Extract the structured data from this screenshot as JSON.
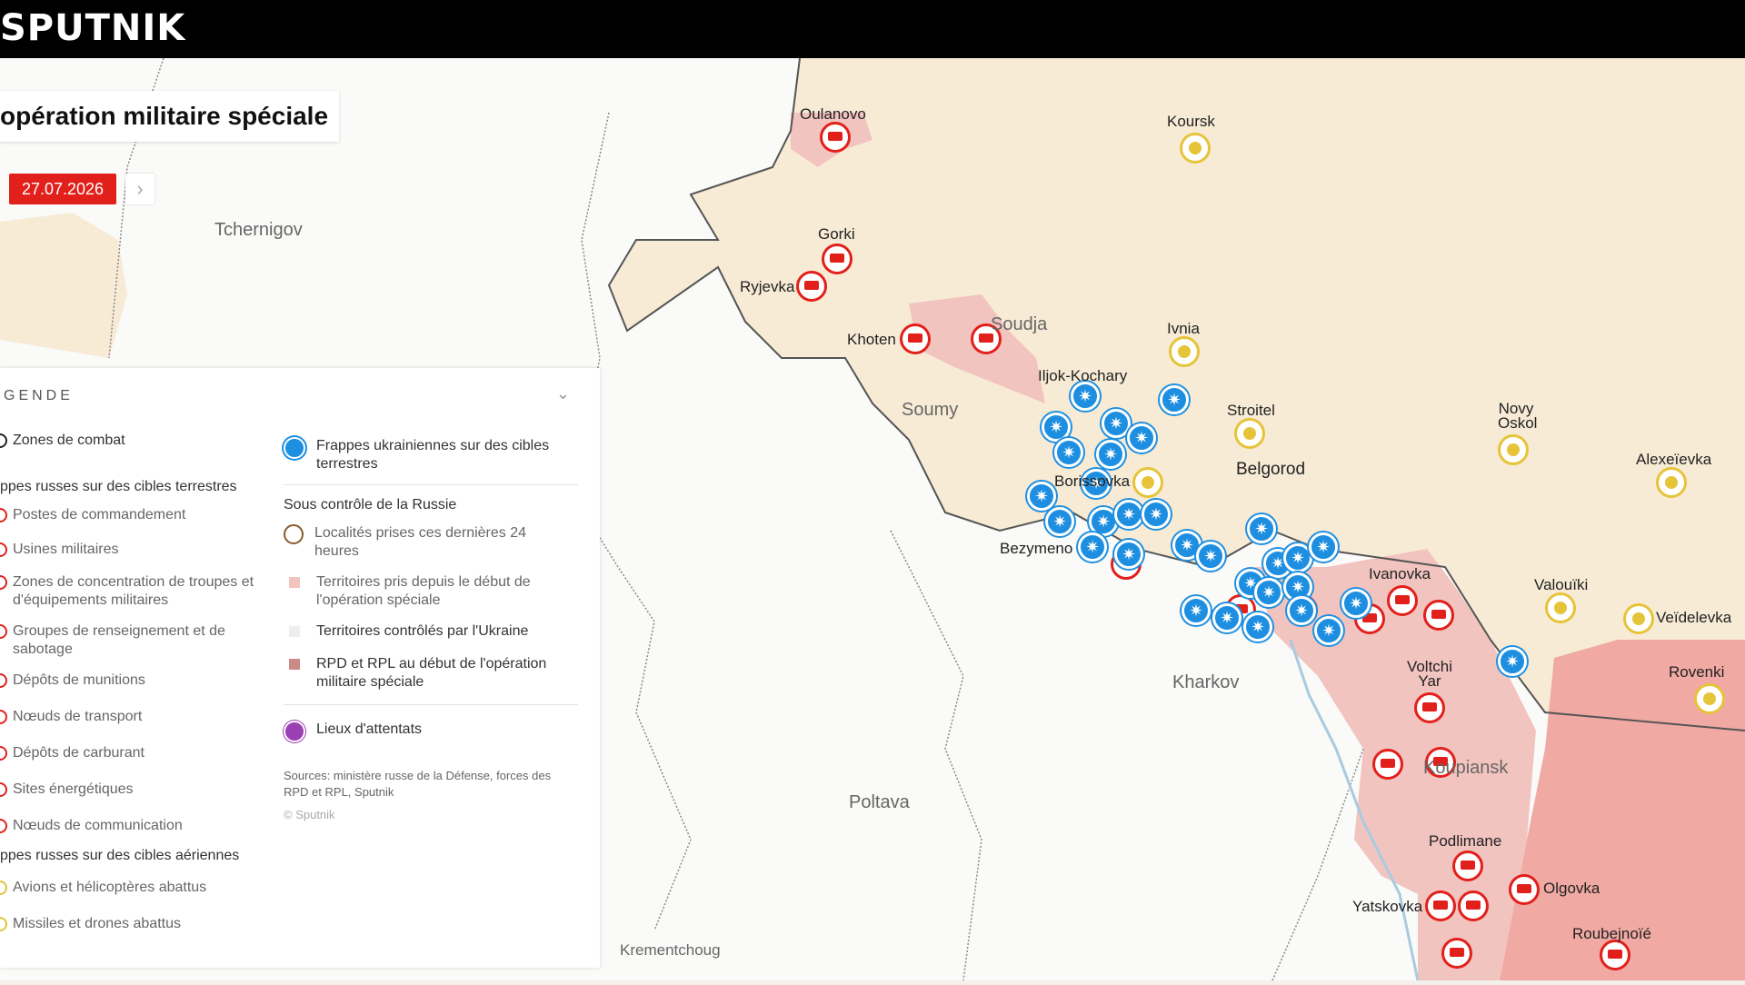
{
  "header": {
    "logo": "SPUTNIK"
  },
  "title": "opération militaire spéciale",
  "date": {
    "label": "27.07.2026",
    "next_glyph": "›"
  },
  "legend": {
    "heading": "GENDE",
    "left": [
      {
        "type": "item",
        "text": "Zones de combat",
        "dot": "k"
      },
      {
        "type": "section",
        "text": "ppes russes sur des cibles terrestres"
      },
      {
        "type": "item",
        "text": "Postes de commandement",
        "dot": "r"
      },
      {
        "type": "item",
        "text": "Usines militaires",
        "dot": "r"
      },
      {
        "type": "item",
        "text": "Zones de concentration de troupes et d'équipements militaires",
        "dot": "r"
      },
      {
        "type": "item",
        "text": "Groupes de renseignement et de sabotage",
        "dot": "r"
      },
      {
        "type": "item",
        "text": "Dépôts de munitions",
        "dot": "r"
      },
      {
        "type": "item",
        "text": "Nœuds de transport",
        "dot": "r"
      },
      {
        "type": "item",
        "text": "Dépôts de carburant",
        "dot": "r"
      },
      {
        "type": "item",
        "text": "Sites énergétiques",
        "dot": "r"
      },
      {
        "type": "item",
        "text": "Nœuds de communication",
        "dot": "r"
      },
      {
        "type": "section",
        "text": "ppes russes sur des cibles aériennes"
      },
      {
        "type": "item",
        "text": "Avions et hélicoptères abattus",
        "dot": "y"
      },
      {
        "type": "item",
        "text": "Missiles et drones abattus",
        "dot": "y"
      }
    ],
    "right": {
      "ukr_strikes": "Frappes ukrainiennes sur des cibles terrestres",
      "control_heading": "Sous contrôle de la Russie",
      "taken_24h": "Localités prises ces dernières 24 heures",
      "taken_since_start": "Territoires pris depuis le début de l'opération spéciale",
      "ukraine_controlled": "Territoires contrôlés par l'Ukraine",
      "rpd_rpl": "RPD et RPL au début de l'opération militaire spéciale",
      "attacks": "Lieux d'attentats",
      "sources": "Sources: ministère russe de la Défense, forces des RPD et RPL, Sputnik",
      "copyright": "© Sputnik"
    }
  },
  "colors": {
    "russia_territory": "#f7ebd6",
    "taken_territory": "#f2c4c0",
    "rpd_rpl": "#f0a9a3",
    "ukraine": "#ffffff",
    "red_marker": "#e2201b",
    "blue_marker": "#1e8fe0",
    "yellow_marker": "#e6c439"
  },
  "cities": [
    {
      "name": "Oulanovo"
    },
    {
      "name": "Koursk"
    },
    {
      "name": "Gorki"
    },
    {
      "name": "Ryjevka"
    },
    {
      "name": "Khoten"
    },
    {
      "name": "Ivnia"
    },
    {
      "name": "Iljok-Kochary"
    },
    {
      "name": "Stroitel"
    },
    {
      "name": "Novy Oskol"
    },
    {
      "name": "Alexeïevka"
    },
    {
      "name": "Borissovka"
    },
    {
      "name": "Belgorod"
    },
    {
      "name": "Bezymeno"
    },
    {
      "name": "Ivanovka"
    },
    {
      "name": "Valouïki"
    },
    {
      "name": "Veïdelevka"
    },
    {
      "name": "Rovenki"
    },
    {
      "name": "Voltchi Yar"
    },
    {
      "name": "Podlimane"
    },
    {
      "name": "Olgovka"
    },
    {
      "name": "Yatskovka"
    },
    {
      "name": "Roubejnoïé"
    }
  ],
  "big_cities": [
    {
      "name": "Tchernigov"
    },
    {
      "name": "Soudja"
    },
    {
      "name": "Soumy"
    },
    {
      "name": "Kharkov"
    },
    {
      "name": "Poltava"
    },
    {
      "name": "Koupiansk"
    },
    {
      "name": "Krementchoug"
    }
  ]
}
